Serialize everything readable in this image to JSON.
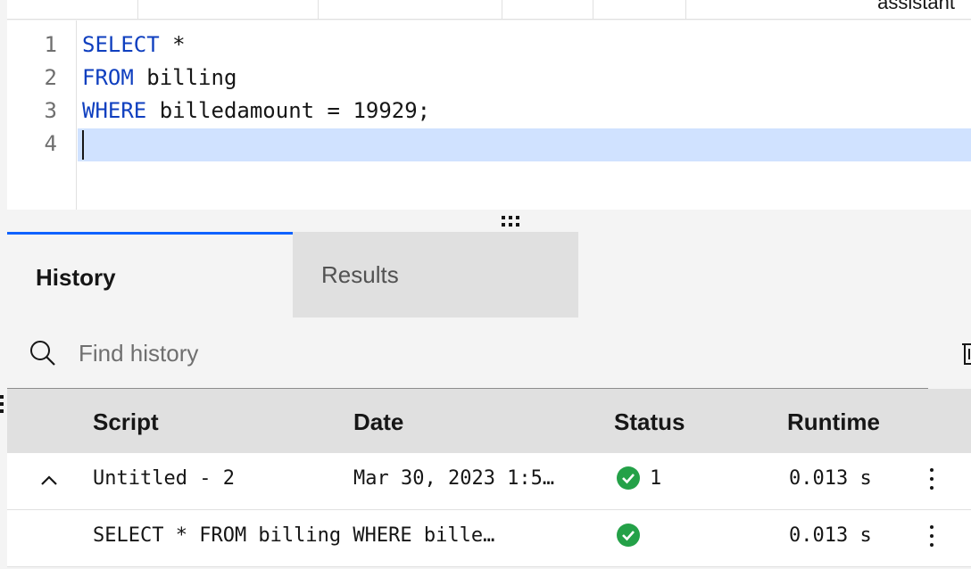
{
  "top_bar": {
    "assistant_label": "assistant"
  },
  "editor": {
    "line_numbers": [
      "1",
      "2",
      "3",
      "4"
    ],
    "lines": [
      {
        "keyword": "SELECT",
        "rest": " *"
      },
      {
        "keyword": "FROM",
        "rest": " billing"
      },
      {
        "keyword": "WHERE",
        "rest": " billedamount = 19929;"
      },
      {
        "keyword": "",
        "rest": ""
      }
    ]
  },
  "tabs": [
    {
      "label": "History",
      "selected": true
    },
    {
      "label": "Results",
      "selected": false
    }
  ],
  "search": {
    "placeholder": "Find history"
  },
  "table": {
    "headers": {
      "script": "Script",
      "date": "Date",
      "status": "Status",
      "runtime": "Runtime"
    },
    "rows": [
      {
        "script": "Untitled - 2",
        "date": "Mar 30, 2023 1:5…",
        "status_count": "1",
        "runtime": "0.013 s"
      },
      {
        "script": "SELECT * FROM billing WHERE bille…",
        "date": "",
        "status_count": "",
        "runtime": "0.013 s"
      }
    ]
  },
  "colors": {
    "accent": "#0f62fe",
    "keyword": "#0f3fbf",
    "success": "#24a148",
    "active_line": "#d0e2ff"
  },
  "icons": [
    "search-icon",
    "trash-icon",
    "chevron-up-icon",
    "checkmark-filled-icon",
    "overflow-menu-vertical-icon",
    "drag-grip-icon"
  ]
}
